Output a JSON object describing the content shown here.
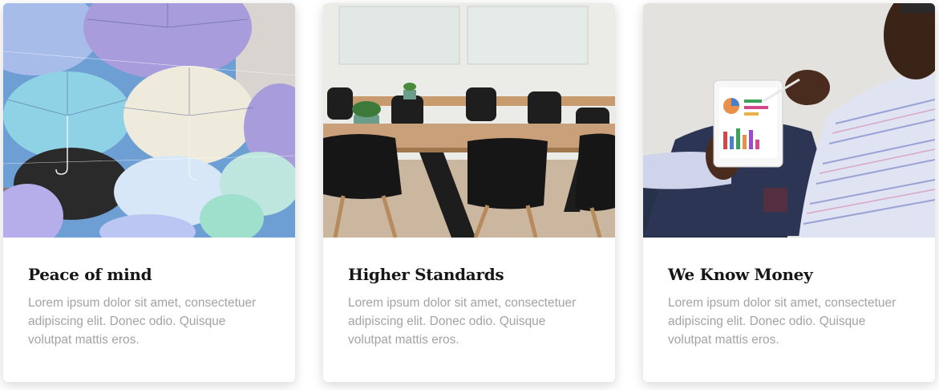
{
  "cards": [
    {
      "image": "umbrellas-photo",
      "title": "Peace of mind",
      "text": "Lorem ipsum dolor sit amet, consectetuer adipiscing elit. Donec odio. Quisque volutpat mattis eros."
    },
    {
      "image": "meeting-room-photo",
      "title": "Higher Standards",
      "text": "Lorem ipsum dolor sit amet, consectetuer adipiscing elit. Donec odio. Quisque volutpat mattis eros."
    },
    {
      "image": "tablet-analytics-photo",
      "title": "We Know Money",
      "text": "Lorem ipsum dolor sit amet, consectetuer adipiscing elit. Donec odio. Quisque volutpat mattis eros."
    }
  ],
  "colors": {
    "title": "#161616",
    "body_text": "#a3a3a3",
    "card_background": "#ffffff"
  }
}
